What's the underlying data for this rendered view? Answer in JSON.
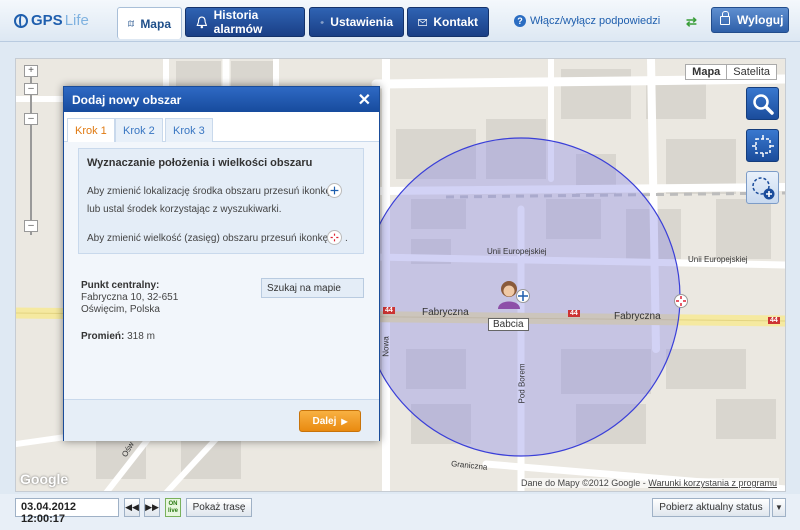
{
  "header": {
    "logo_gps": "GPS",
    "logo_life": "Life",
    "tabs": [
      {
        "label": "Mapa",
        "icon": "map-icon"
      },
      {
        "label": "Historia alarmów",
        "icon": "bell-icon"
      },
      {
        "label": "Ustawienia",
        "icon": "gear-icon"
      },
      {
        "label": "Kontakt",
        "icon": "envelope-icon"
      }
    ],
    "hints_label": "Włącz/wyłącz podpowiedzi",
    "logout_label": "Wyloguj"
  },
  "map": {
    "type_options": [
      "Mapa",
      "Satelita"
    ],
    "selected_type": "Mapa",
    "street_labels": {
      "fabryczna_left": "Fabryczna",
      "fabryczna_right": "Fabryczna",
      "unii_1": "Unii Europejskiej",
      "unii_2": "Unii Europejskiej",
      "pod_borem": "Pod Borem",
      "graniczna": "Graniczna",
      "nowa": "Nowa",
      "osw": "Ośw",
      "route_badge": "44"
    },
    "person_label": "Babcia",
    "google": "Google",
    "copyright": "Dane do Mapy ©2012 Google -",
    "terms_link": "Warunki korzystania z programu",
    "area_color": "#8e8fe6",
    "area_stroke": "#3a3fd8"
  },
  "dialog": {
    "title": "Dodaj nowy obszar",
    "steps": [
      "Krok 1",
      "Krok 2",
      "Krok 3"
    ],
    "active_step": "Krok 1",
    "info_heading": "Wyznaczanie położenia i wielkości obszaru",
    "info_line1": "Aby zmienić lokalizację środka obszaru przesuń ikonkę",
    "info_line2": "lub ustal środek korzystając z wyszukiwarki.",
    "info_line3": "Aby zmienić wielkość (zasięg) obszaru przesuń ikonkę",
    "info_line3_end": ".",
    "center_label": "Punkt centralny:",
    "center_line1": "Fabryczna 10, 32-651",
    "center_line2": "Oświęcim, Polska",
    "search_on_map": "Szukaj na mapie",
    "radius_label": "Promień:",
    "radius_value": "318 m",
    "next_label": "Dalej"
  },
  "footer": {
    "date": "03.04.2012 12:00:17",
    "live_top": "ON",
    "live_bottom": "live",
    "show_route": "Pokaż trasę",
    "get_status": "Pobierz aktualny status"
  }
}
